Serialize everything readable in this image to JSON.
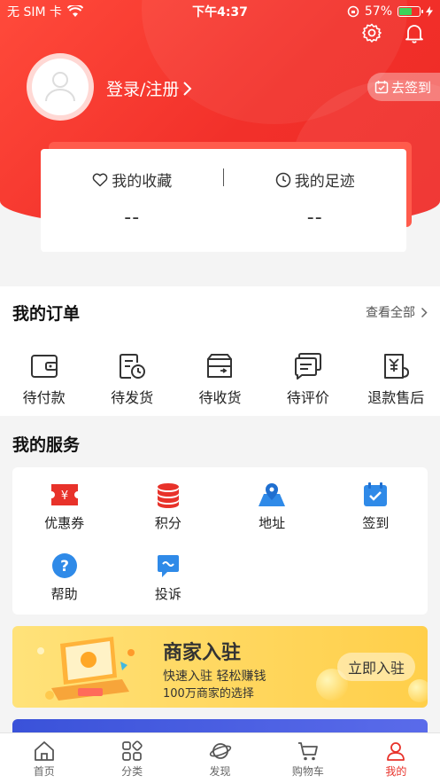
{
  "status_bar": {
    "carrier": "无 SIM 卡",
    "time": "下午4:37",
    "battery": "57%"
  },
  "profile": {
    "login_label": "登录/注册",
    "signin_label": "去签到"
  },
  "favorites": {
    "collect_label": "我的收藏",
    "collect_value": "--",
    "footprint_label": "我的足迹",
    "footprint_value": "--"
  },
  "orders": {
    "title": "我的订单",
    "view_all": "查看全部",
    "items": [
      {
        "label": "待付款",
        "icon": "wallet-icon"
      },
      {
        "label": "待发货",
        "icon": "pending-ship-icon"
      },
      {
        "label": "待收货",
        "icon": "delivery-box-icon"
      },
      {
        "label": "待评价",
        "icon": "comment-icon"
      },
      {
        "label": "退款售后",
        "icon": "refund-icon"
      }
    ]
  },
  "services": {
    "title": "我的服务",
    "items": [
      {
        "label": "优惠券",
        "icon": "coupon-icon",
        "color": "#e8322a"
      },
      {
        "label": "积分",
        "icon": "points-icon",
        "color": "#e8322a"
      },
      {
        "label": "地址",
        "icon": "map-pin-icon",
        "color": "#2f8ae8"
      },
      {
        "label": "签到",
        "icon": "calendar-check-icon",
        "color": "#2f8ae8"
      },
      {
        "label": "帮助",
        "icon": "help-icon",
        "color": "#2f8ae8"
      },
      {
        "label": "投诉",
        "icon": "complaint-icon",
        "color": "#2f8ae8"
      }
    ]
  },
  "merchant_banner": {
    "title": "商家入驻",
    "subtitle": "快速入驻 轻松赚钱",
    "note": "100万商家的选择",
    "button": "立即入驻"
  },
  "tabbar": {
    "items": [
      {
        "label": "首页",
        "icon": "home-icon"
      },
      {
        "label": "分类",
        "icon": "category-icon"
      },
      {
        "label": "发现",
        "icon": "planet-icon"
      },
      {
        "label": "购物车",
        "icon": "cart-icon"
      },
      {
        "label": "我的",
        "icon": "person-icon"
      }
    ],
    "active_index": 4,
    "active_color": "#e8322a"
  }
}
